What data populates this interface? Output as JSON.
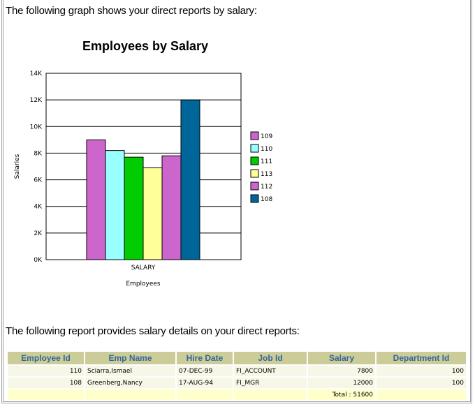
{
  "intro_text": "The following graph shows your direct reports by salary:",
  "report_intro_text": "The following report provides salary details on your direct reports:",
  "chart_data": {
    "type": "bar",
    "title": "Employees by Salary",
    "xlabel": "Employees",
    "ylabel": "Salaries",
    "categories": [
      "SALARY"
    ],
    "series": [
      {
        "name": "109",
        "values": [
          9000
        ],
        "color": "#cc66cc"
      },
      {
        "name": "110",
        "values": [
          8200
        ],
        "color": "#99ffff"
      },
      {
        "name": "111",
        "values": [
          7700
        ],
        "color": "#00cc00"
      },
      {
        "name": "113",
        "values": [
          6900
        ],
        "color": "#ffff99"
      },
      {
        "name": "112",
        "values": [
          7800
        ],
        "color": "#cc66cc"
      },
      {
        "name": "108",
        "values": [
          12000
        ],
        "color": "#006699"
      }
    ],
    "ylim": [
      0,
      14000
    ],
    "yticks": [
      0,
      2000,
      4000,
      6000,
      8000,
      10000,
      12000,
      14000
    ],
    "ytick_labels": [
      "0K",
      "2K",
      "4K",
      "6K",
      "8K",
      "10K",
      "12K",
      "14K"
    ],
    "grid": true,
    "legend": "right"
  },
  "report": {
    "headers": [
      "Employee Id",
      "Emp Name",
      "Hire Date",
      "Job Id",
      "Salary",
      "Department Id"
    ],
    "rows": [
      [
        "110",
        "Sciarra,Ismael",
        "07-DEC-99",
        "FI_ACCOUNT",
        "7800",
        "100"
      ],
      [
        "108",
        "Greenberg,Nancy",
        "17-AUG-94",
        "FI_MGR",
        "12000",
        "100"
      ]
    ],
    "total_label": "Total : 51600"
  }
}
